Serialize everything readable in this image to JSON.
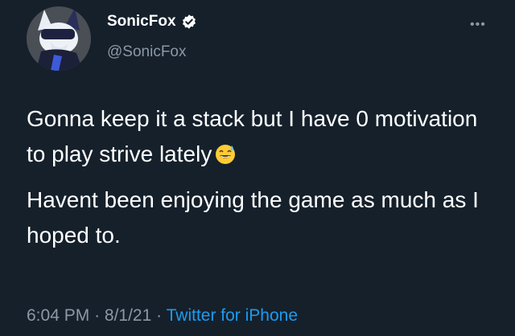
{
  "author": {
    "display_name": "SonicFox",
    "handle": "@SonicFox"
  },
  "more_label": "•••",
  "tweet": {
    "paragraph1": "Gonna keep it a stack but I have 0 motivation to play strive lately",
    "paragraph2": "Havent been enjoying the game as much as I hoped to."
  },
  "meta": {
    "time": "6:04 PM",
    "separator": "·",
    "date": "8/1/21",
    "source": "Twitter for iPhone"
  },
  "colors": {
    "background": "#15202b",
    "secondary_text": "#8b98a5",
    "link": "#1d9bf0",
    "verified": "#1d9bf0"
  },
  "icons": [
    "avatar",
    "verified-badge-icon",
    "more-icon",
    "grinning-sweat-emoji"
  ]
}
